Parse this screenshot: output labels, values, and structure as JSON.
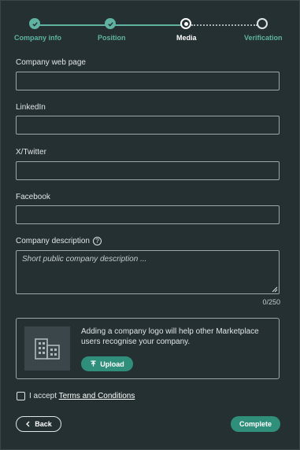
{
  "stepper": {
    "steps": [
      {
        "label": "Company info",
        "state": "done"
      },
      {
        "label": "Position",
        "state": "done"
      },
      {
        "label": "Media",
        "state": "current"
      },
      {
        "label": "Verification",
        "state": "todo"
      }
    ]
  },
  "form": {
    "web_page": {
      "label": "Company web page",
      "value": ""
    },
    "linkedin": {
      "label": "LinkedIn",
      "value": ""
    },
    "twitter": {
      "label": "X/Twitter",
      "value": ""
    },
    "facebook": {
      "label": "Facebook",
      "value": ""
    },
    "description": {
      "label": "Company description",
      "help": "?",
      "placeholder": "Short public company description ...",
      "value": "",
      "counter": "0/250"
    }
  },
  "logo": {
    "hint": "Adding a company logo will help other Marketplace users recognise your company.",
    "upload_label": "Upload",
    "icon": "building-icon"
  },
  "terms": {
    "prefix": "I accept ",
    "link_text": "Terms and Conditions",
    "checked": false
  },
  "actions": {
    "back_label": "Back",
    "complete_label": "Complete"
  },
  "colors": {
    "background": "#253033",
    "accent": "#2f8f7a",
    "step_done": "#5fb3a0"
  }
}
